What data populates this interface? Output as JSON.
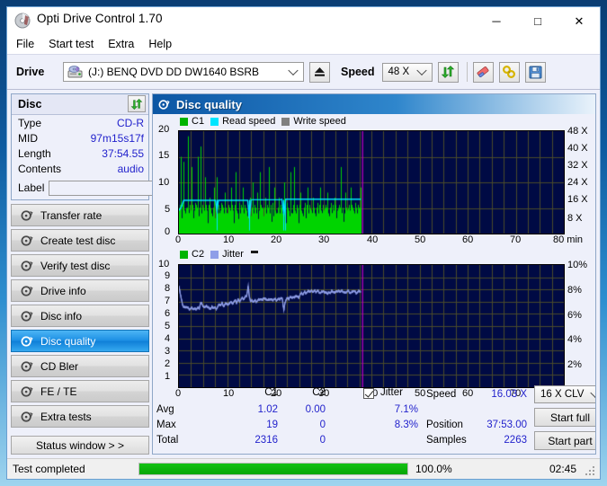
{
  "window": {
    "title": "Opti Drive Control 1.70",
    "minimize_label": "─",
    "maximize_label": "□",
    "close_label": "✕"
  },
  "menu": {
    "items": [
      "File",
      "Start test",
      "Extra",
      "Help"
    ]
  },
  "toolbar": {
    "drive_label": "Drive",
    "drive_value": "(J:)   BENQ DVD DD DW1640 BSRB",
    "eject_title": "Eject",
    "speed_label": "Speed",
    "speed_value": "48 X",
    "refresh_title": "Refresh",
    "erase_title": "Erase",
    "bookmark_title": "Bookmark",
    "save_title": "Save"
  },
  "disc_panel": {
    "title": "Disc",
    "rows": [
      {
        "key": "Type",
        "value": "CD-R"
      },
      {
        "key": "MID",
        "value": "97m15s17f"
      },
      {
        "key": "Length",
        "value": "37:54.55"
      },
      {
        "key": "Contents",
        "value": "audio"
      }
    ],
    "label_key": "Label",
    "label_value": ""
  },
  "sidebar": {
    "items": [
      {
        "label": "Transfer rate",
        "selected": false
      },
      {
        "label": "Create test disc",
        "selected": false
      },
      {
        "label": "Verify test disc",
        "selected": false
      },
      {
        "label": "Drive info",
        "selected": false
      },
      {
        "label": "Disc info",
        "selected": false
      },
      {
        "label": "Disc quality",
        "selected": true
      },
      {
        "label": "CD Bler",
        "selected": false
      },
      {
        "label": "FE / TE",
        "selected": false
      },
      {
        "label": "Extra tests",
        "selected": false
      }
    ],
    "status_window_label": "Status window > >"
  },
  "panel": {
    "title": "Disc quality"
  },
  "stats": {
    "col_c1": "C1",
    "col_c2": "C2",
    "row_avg": "Avg",
    "row_max": "Max",
    "row_total": "Total",
    "c1_avg": "1.02",
    "c1_max": "19",
    "c1_total": "2316",
    "c2_avg": "0.00",
    "c2_max": "0",
    "c2_total": "0",
    "jitter_label": "Jitter",
    "jitter_checked": true,
    "jitter_avg": "7.1%",
    "jitter_max": "8.3%",
    "speed_label": "Speed",
    "speed_value": "16.03 X",
    "position_label": "Position",
    "position_value": "37:53.00",
    "samples_label": "Samples",
    "samples_value": "2263",
    "write_mode": "16 X CLV",
    "start_full": "Start full",
    "start_part": "Start part"
  },
  "statusbar": {
    "text": "Test completed",
    "percent_text": "100.0%",
    "percent_value": 100,
    "elapsed": "02:45"
  },
  "colors": {
    "c1": "#00d400",
    "c2": "#00d400",
    "read_speed": "#00e5ff",
    "write_speed": "#808080",
    "jitter": "#8f9ee8",
    "plot_bg": "#000a44",
    "grid": "#4a4a28",
    "marker": "#c000c0",
    "accent": "#2222cc",
    "progress": "#06a606"
  },
  "chart_data": [
    {
      "type": "line",
      "title": "C1 / Read speed / Write speed",
      "legend": [
        {
          "name": "C1",
          "color": "#00b400"
        },
        {
          "name": "Read speed",
          "color": "#00e5ff"
        },
        {
          "name": "Write speed",
          "color": "#808080"
        }
      ],
      "legend_position": "top-left",
      "grid": true,
      "xlabel": "min",
      "x_tick_labels": [
        "0",
        "10",
        "20",
        "30",
        "40",
        "50",
        "60",
        "70",
        "80 min"
      ],
      "xlim": [
        0,
        80
      ],
      "ylabel_left": "C1",
      "y_tick_labels_left": [
        "0",
        "5",
        "10",
        "15",
        "20"
      ],
      "ylim_left": [
        0,
        20
      ],
      "ylabel_right": "Speed",
      "y_tick_labels_right": [
        "8 X",
        "16 X",
        "24 X",
        "32 X",
        "40 X",
        "48 X"
      ],
      "ylim_right": [
        0,
        48
      ],
      "data_end_x": 37.9,
      "marker_x": 37.9,
      "series": [
        {
          "name": "C1",
          "color": "#00d400",
          "x": [
            0.0,
            0.3,
            0.6,
            0.9,
            1.2,
            1.5,
            1.8,
            2.1,
            2.4,
            2.7,
            3.0,
            3.3,
            3.6,
            3.9,
            4.2,
            4.5,
            4.8,
            5.1,
            5.4,
            5.7,
            6.0,
            6.3,
            6.6,
            6.9,
            7.2,
            7.5,
            7.8,
            8.1,
            8.4,
            8.7,
            9.0,
            9.3,
            9.6,
            9.9,
            10.2,
            10.5,
            10.8,
            11.1,
            11.4,
            11.7,
            12.0,
            12.3,
            12.6,
            12.9,
            13.2,
            13.5,
            13.8,
            14.1,
            14.4,
            14.7,
            15.0,
            15.3,
            15.6,
            15.9,
            16.2,
            16.5,
            16.8,
            17.1,
            17.4,
            17.7,
            18.0,
            18.3,
            18.6,
            18.9,
            19.2,
            19.5,
            19.8,
            20.1,
            20.4,
            20.7,
            21.0,
            21.3,
            21.6,
            21.9,
            22.2,
            22.5,
            22.8,
            23.1,
            23.4,
            23.7,
            24.0,
            24.3,
            24.6,
            24.9,
            25.2,
            25.5,
            25.8,
            26.1,
            26.4,
            26.7,
            27.0,
            27.3,
            27.6,
            27.9,
            28.2,
            28.5,
            28.8,
            29.1,
            29.4,
            29.7,
            30.0,
            30.3,
            30.6,
            30.9,
            31.2,
            31.5,
            31.8,
            32.1,
            32.4,
            32.7,
            33.0,
            33.3,
            33.6,
            33.9,
            34.2,
            34.5,
            34.8,
            35.1,
            35.4,
            35.7,
            36.0,
            36.3,
            36.6,
            36.9,
            37.2,
            37.5,
            37.8
          ],
          "y": [
            5,
            15,
            3,
            14,
            2,
            5,
            19,
            4,
            2,
            13,
            3,
            6,
            2,
            15,
            3,
            17,
            4,
            2,
            11,
            3,
            2,
            7,
            5,
            2,
            9,
            3,
            11,
            2,
            4,
            6,
            3,
            2,
            8,
            4,
            2,
            5,
            9,
            3,
            2,
            12,
            4,
            2,
            6,
            3,
            9,
            2,
            5,
            4,
            2,
            7,
            3,
            10,
            2,
            5,
            8,
            2,
            12,
            3,
            5,
            2,
            7,
            4,
            13,
            3,
            2,
            6,
            9,
            2,
            4,
            7,
            3,
            2,
            5,
            10,
            2,
            6,
            3,
            12,
            4,
            2,
            13,
            3,
            5,
            2,
            8,
            4,
            2,
            6,
            3,
            9,
            2,
            5,
            4,
            7,
            2,
            3,
            6,
            2,
            9,
            4,
            2,
            5,
            3,
            8,
            2,
            6,
            4,
            2,
            7,
            3,
            5,
            2,
            13,
            4,
            2,
            8,
            3,
            5,
            2,
            9,
            4,
            2,
            6,
            3,
            2,
            5,
            9
          ]
        },
        {
          "name": "Read speed",
          "color": "#00e5ff",
          "x": [
            0,
            0.5,
            1,
            2,
            3,
            4,
            5,
            6,
            7,
            7.6,
            7.9,
            8.2,
            9,
            11,
            13,
            14.3,
            14.6,
            15,
            17,
            19,
            21,
            21.4,
            21.8,
            22.2,
            24,
            26,
            28,
            30,
            32,
            34,
            36,
            37.8
          ],
          "y": [
            4.5,
            5.2,
            6.5,
            6.5,
            6.5,
            6.5,
            6.5,
            6.5,
            6.5,
            6.5,
            4.4,
            6.5,
            6.5,
            6.5,
            6.5,
            6.5,
            3.0,
            6.6,
            6.6,
            6.6,
            6.6,
            6.7,
            3.6,
            6.7,
            6.7,
            6.7,
            6.7,
            6.7,
            6.7,
            6.7,
            6.7,
            6.7
          ]
        }
      ]
    },
    {
      "type": "line",
      "title": "C2 / Jitter",
      "legend": [
        {
          "name": "C2",
          "color": "#00b400"
        },
        {
          "name": "Jitter",
          "color": "#8f9ee8"
        }
      ],
      "legend_position": "top-left",
      "grid": true,
      "xlabel": "min",
      "x_tick_labels": [
        "0",
        "10",
        "20",
        "30",
        "40",
        "50",
        "60",
        "70",
        "80 min"
      ],
      "xlim": [
        0,
        80
      ],
      "ylabel_left": "C2",
      "y_tick_labels_left": [
        "1",
        "2",
        "3",
        "4",
        "5",
        "6",
        "7",
        "8",
        "9",
        "10"
      ],
      "ylim_left": [
        0,
        10
      ],
      "ylabel_right": "Jitter",
      "y_tick_labels_right": [
        "2%",
        "4%",
        "6%",
        "8%",
        "10%"
      ],
      "ylim_right": [
        0,
        10
      ],
      "data_end_x": 37.9,
      "marker_x": 37.9,
      "series": [
        {
          "name": "Jitter",
          "color": "#8f9ee8",
          "x": [
            0.0,
            0.3,
            0.6,
            0.9,
            1.2,
            1.5,
            1.8,
            2.1,
            2.4,
            2.7,
            3.0,
            3.3,
            3.6,
            3.9,
            4.2,
            4.5,
            4.8,
            5.1,
            5.4,
            5.7,
            6.0,
            6.3,
            6.6,
            6.9,
            7.2,
            7.5,
            7.8,
            8.1,
            8.4,
            8.7,
            9.0,
            9.3,
            9.6,
            9.9,
            10.2,
            10.5,
            10.8,
            11.1,
            11.4,
            11.7,
            12.0,
            12.3,
            12.6,
            12.9,
            13.2,
            13.5,
            13.8,
            14.1,
            14.4,
            14.6,
            14.9,
            15.2,
            15.5,
            15.8,
            16.1,
            16.4,
            16.7,
            17.0,
            17.3,
            17.6,
            17.9,
            18.2,
            18.5,
            18.8,
            19.1,
            19.4,
            19.7,
            20.0,
            20.3,
            20.6,
            20.9,
            21.2,
            21.5,
            21.8,
            22.0,
            22.2,
            22.5,
            22.8,
            23.1,
            23.4,
            23.7,
            24.0,
            24.3,
            24.6,
            24.9,
            25.2,
            25.5,
            25.8,
            26.1,
            26.4,
            26.7,
            27.0,
            27.3,
            27.6,
            27.9,
            28.2,
            28.5,
            28.8,
            29.1,
            29.4,
            29.7,
            30.0,
            30.3,
            30.6,
            30.9,
            31.2,
            31.5,
            31.8,
            32.1,
            32.4,
            32.7,
            33.0,
            33.3,
            33.6,
            33.9,
            34.2,
            34.5,
            34.8,
            35.1,
            35.4,
            35.7,
            36.0,
            36.3,
            36.6,
            36.9,
            37.2,
            37.5,
            37.8
          ],
          "y": [
            8.3,
            7.6,
            7.0,
            6.6,
            6.5,
            6.6,
            6.5,
            6.4,
            6.4,
            6.5,
            6.4,
            6.4,
            6.4,
            6.5,
            6.4,
            6.9,
            6.8,
            6.6,
            6.5,
            6.7,
            6.5,
            6.5,
            6.4,
            6.6,
            6.5,
            6.5,
            6.4,
            6.6,
            6.8,
            6.7,
            6.9,
            6.6,
            6.8,
            6.9,
            6.7,
            6.9,
            7.0,
            6.8,
            7.0,
            7.1,
            6.9,
            7.2,
            7.0,
            7.2,
            7.3,
            7.2,
            7.4,
            7.5,
            8.3,
            7.5,
            7.0,
            7.1,
            7.0,
            7.1,
            7.0,
            7.1,
            7.2,
            7.2,
            7.1,
            7.3,
            7.2,
            7.2,
            7.1,
            7.2,
            7.2,
            7.1,
            7.2,
            7.2,
            7.1,
            7.2,
            7.2,
            7.3,
            7.2,
            6.3,
            6.8,
            7.1,
            7.3,
            7.2,
            7.4,
            7.3,
            7.4,
            7.3,
            7.5,
            7.4,
            7.3,
            7.6,
            7.7,
            7.6,
            7.8,
            7.7,
            7.8,
            7.9,
            7.8,
            7.9,
            7.8,
            7.9,
            7.8,
            7.9,
            7.8,
            7.7,
            7.8,
            7.9,
            7.7,
            7.8,
            7.6,
            7.8,
            7.7,
            7.9,
            7.8,
            7.7,
            7.9,
            7.8,
            7.9,
            7.8,
            7.9,
            7.8,
            7.7,
            7.8,
            7.9,
            7.8,
            7.7,
            7.8,
            7.9,
            7.8,
            7.7,
            7.8,
            7.9,
            7.8
          ]
        }
      ]
    }
  ]
}
